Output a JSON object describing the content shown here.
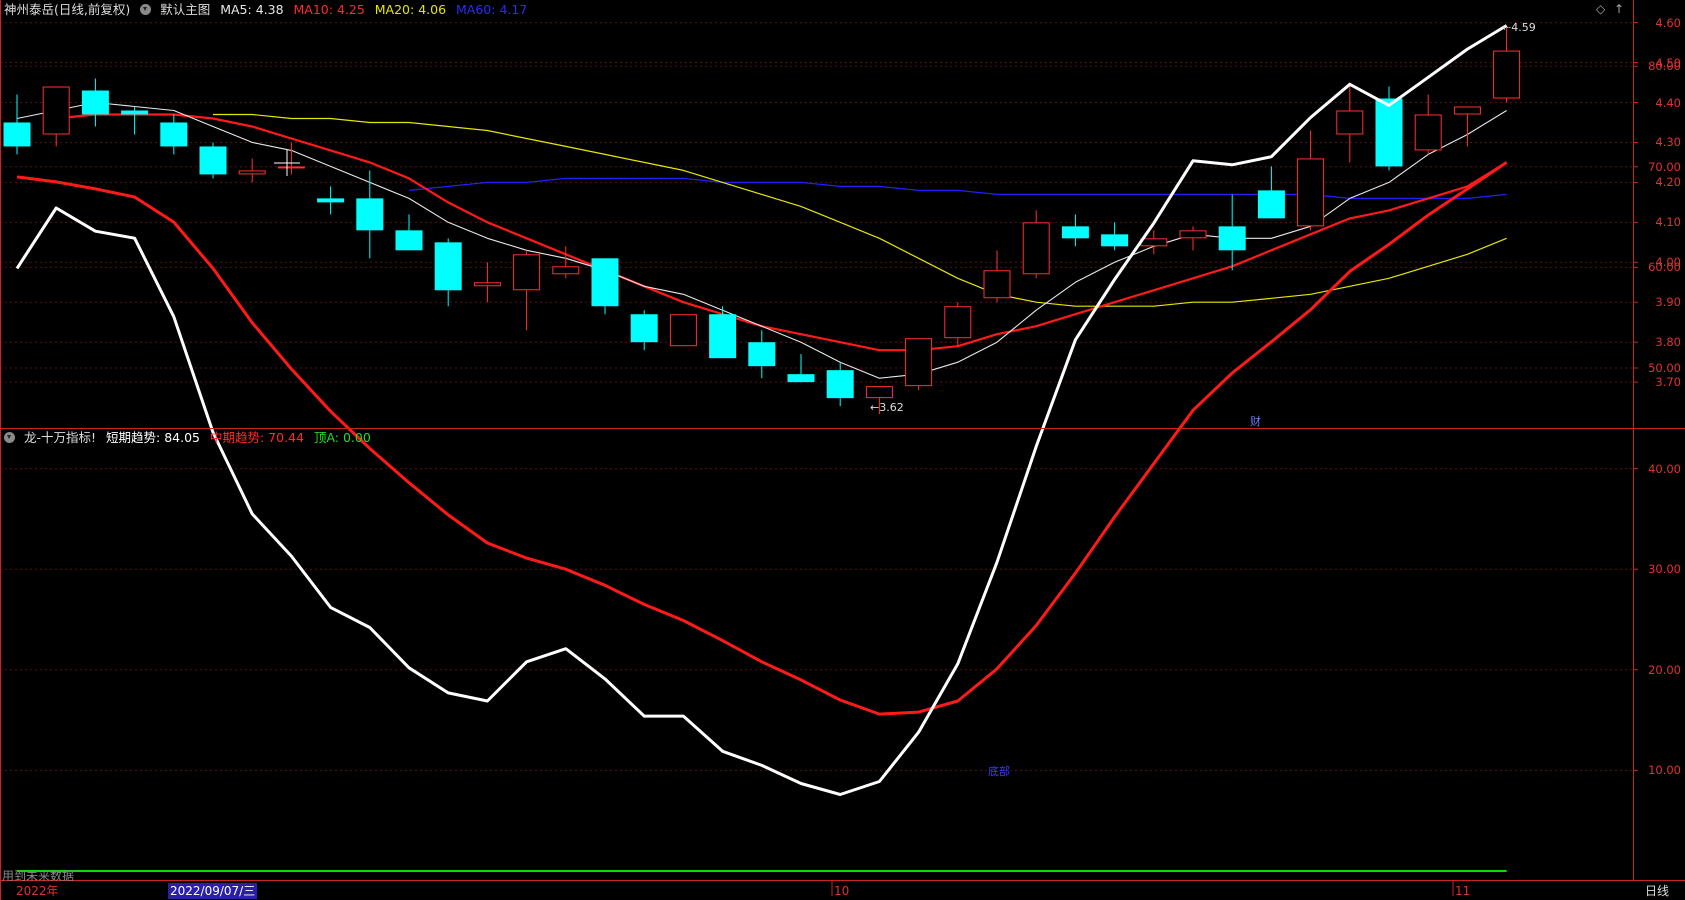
{
  "header": {
    "stock": "神州泰岳(日线,前复权)",
    "main_chart": "默认主图",
    "ma5": "MA5: 4.38",
    "ma10": "MA10: 4.25",
    "ma20": "MA20: 4.06",
    "ma60": "MA60: 4.17"
  },
  "indicator": {
    "name": "龙-十万指标!",
    "short": "短期趋势: 84.05",
    "mid": "中期趋势: 70.44",
    "top": "顶A: 0.00"
  },
  "footer": {
    "future_data": "用到未来数据",
    "year": "2022年",
    "date": "2022/09/07/三",
    "m10": "10",
    "m11": "11",
    "period": "日线"
  },
  "annotations": {
    "high": "4.59",
    "low": "3.62",
    "cai": "财",
    "signal": "底部"
  },
  "colors": {
    "up": "#ff3030",
    "down": "#00ffff",
    "ma5": "#e8e8e8",
    "ma10": "#ff1a1a",
    "ma20": "#e6e600",
    "ma60": "#2020ff",
    "short": "#ffffff",
    "mid": "#ff1a1a",
    "top": "#00e000",
    "axis": "#cc2222"
  },
  "chart_data": [
    {
      "type": "candlestick",
      "title": "神州泰岳(日线,前复权)",
      "ylim": [
        3.6,
        4.62
      ],
      "yticks": [
        "3.70",
        "3.80",
        "3.90",
        "4.00",
        "4.10",
        "4.20",
        "4.30",
        "4.40",
        "4.50",
        "4.60"
      ],
      "candles": [
        {
          "o": 4.35,
          "h": 4.42,
          "l": 4.27,
          "c": 4.29
        },
        {
          "o": 4.32,
          "h": 4.44,
          "l": 4.29,
          "c": 4.44
        },
        {
          "o": 4.43,
          "h": 4.46,
          "l": 4.34,
          "c": 4.37
        },
        {
          "o": 4.38,
          "h": 4.39,
          "l": 4.32,
          "c": 4.37
        },
        {
          "o": 4.35,
          "h": 4.37,
          "l": 4.27,
          "c": 4.29
        },
        {
          "o": 4.29,
          "h": 4.3,
          "l": 4.21,
          "c": 4.22
        },
        {
          "o": 4.22,
          "h": 4.26,
          "l": 4.2,
          "c": 4.23
        },
        {
          "o": 4.24,
          "h": 4.3,
          "l": 4.22,
          "c": 4.24
        },
        {
          "o": 4.16,
          "h": 4.19,
          "l": 4.12,
          "c": 4.15
        },
        {
          "o": 4.16,
          "h": 4.23,
          "l": 4.01,
          "c": 4.08
        },
        {
          "o": 4.08,
          "h": 4.12,
          "l": 4.03,
          "c": 4.03
        },
        {
          "o": 4.05,
          "h": 4.06,
          "l": 3.89,
          "c": 3.93
        },
        {
          "o": 3.94,
          "h": 4.0,
          "l": 3.9,
          "c": 3.95
        },
        {
          "o": 3.93,
          "h": 4.03,
          "l": 3.83,
          "c": 4.02
        },
        {
          "o": 3.97,
          "h": 4.04,
          "l": 3.96,
          "c": 3.99
        },
        {
          "o": 4.01,
          "h": 4.01,
          "l": 3.87,
          "c": 3.89
        },
        {
          "o": 3.87,
          "h": 3.88,
          "l": 3.78,
          "c": 3.8
        },
        {
          "o": 3.79,
          "h": 3.87,
          "l": 3.79,
          "c": 3.87
        },
        {
          "o": 3.87,
          "h": 3.89,
          "l": 3.76,
          "c": 3.76
        },
        {
          "o": 3.8,
          "h": 3.83,
          "l": 3.71,
          "c": 3.74
        },
        {
          "o": 3.72,
          "h": 3.77,
          "l": 3.7,
          "c": 3.7
        },
        {
          "o": 3.73,
          "h": 3.75,
          "l": 3.64,
          "c": 3.66
        },
        {
          "o": 3.66,
          "h": 3.69,
          "l": 3.62,
          "c": 3.69
        },
        {
          "o": 3.69,
          "h": 3.81,
          "l": 3.68,
          "c": 3.81
        },
        {
          "o": 3.81,
          "h": 3.9,
          "l": 3.79,
          "c": 3.89
        },
        {
          "o": 3.91,
          "h": 4.03,
          "l": 3.9,
          "c": 3.98
        },
        {
          "o": 3.97,
          "h": 4.13,
          "l": 3.96,
          "c": 4.1
        },
        {
          "o": 4.09,
          "h": 4.12,
          "l": 4.04,
          "c": 4.06
        },
        {
          "o": 4.07,
          "h": 4.1,
          "l": 4.03,
          "c": 4.04
        },
        {
          "o": 4.04,
          "h": 4.08,
          "l": 4.02,
          "c": 4.06
        },
        {
          "o": 4.06,
          "h": 4.09,
          "l": 4.03,
          "c": 4.08
        },
        {
          "o": 4.09,
          "h": 4.17,
          "l": 3.98,
          "c": 4.03
        },
        {
          "o": 4.18,
          "h": 4.24,
          "l": 4.11,
          "c": 4.11
        },
        {
          "o": 4.09,
          "h": 4.33,
          "l": 4.08,
          "c": 4.26
        },
        {
          "o": 4.32,
          "h": 4.45,
          "l": 4.25,
          "c": 4.38
        },
        {
          "o": 4.41,
          "h": 4.44,
          "l": 4.23,
          "c": 4.24
        },
        {
          "o": 4.28,
          "h": 4.42,
          "l": 4.27,
          "c": 4.37
        },
        {
          "o": 4.37,
          "h": 4.39,
          "l": 4.29,
          "c": 4.39
        },
        {
          "o": 4.41,
          "h": 4.59,
          "l": 4.4,
          "c": 4.53
        }
      ],
      "ma": {
        "MA5": [
          4.36,
          4.38,
          4.4,
          4.39,
          4.38,
          4.34,
          4.3,
          4.28,
          4.24,
          4.2,
          4.16,
          4.1,
          4.06,
          4.03,
          4.01,
          3.98,
          3.94,
          3.92,
          3.88,
          3.84,
          3.8,
          3.75,
          3.71,
          3.72,
          3.75,
          3.8,
          3.88,
          3.95,
          4.0,
          4.04,
          4.07,
          4.06,
          4.06,
          4.09,
          4.16,
          4.2,
          4.27,
          4.32,
          4.38
        ],
        "MA10": [
          4.36,
          4.37,
          4.37,
          4.37,
          4.36,
          4.34,
          4.31,
          4.28,
          4.25,
          4.21,
          4.15,
          4.1,
          4.06,
          4.02,
          3.98,
          3.94,
          3.9,
          3.87,
          3.84,
          3.82,
          3.8,
          3.78,
          3.78,
          3.79,
          3.82,
          3.84,
          3.87,
          3.9,
          3.93,
          3.96,
          3.99,
          4.03,
          4.07,
          4.11,
          4.13,
          4.16,
          4.19,
          4.25
        ],
        "MA20": [
          4.37,
          4.37,
          4.36,
          4.36,
          4.35,
          4.35,
          4.34,
          4.33,
          4.31,
          4.29,
          4.27,
          4.25,
          4.23,
          4.2,
          4.17,
          4.14,
          4.1,
          4.06,
          4.01,
          3.96,
          3.92,
          3.9,
          3.89,
          3.89,
          3.89,
          3.9,
          3.9,
          3.91,
          3.92,
          3.94,
          3.96,
          3.99,
          4.02,
          4.06
        ],
        "MA60": [
          4.18,
          4.19,
          4.2,
          4.2,
          4.21,
          4.21,
          4.21,
          4.21,
          4.2,
          4.2,
          4.2,
          4.19,
          4.19,
          4.18,
          4.18,
          4.17,
          4.17,
          4.17,
          4.17,
          4.17,
          4.17,
          4.17,
          4.17,
          4.17,
          4.16,
          4.16,
          4.16,
          4.16,
          4.17
        ]
      },
      "high_label": 4.59,
      "low_label": 3.62
    },
    {
      "type": "line",
      "title": "龙-十万指标!",
      "ylim": [
        0,
        90
      ],
      "yticks": [
        "10.00",
        "20.00",
        "30.00",
        "40.00",
        "50.00",
        "60.00",
        "70.00",
        "80.00"
      ],
      "series": [
        {
          "name": "短期趋势",
          "values": [
            59.9,
            65.9,
            63.6,
            62.9,
            55.1,
            43.6,
            35.5,
            31.3,
            26.2,
            24.2,
            20.2,
            17.7,
            16.9,
            20.8,
            22.1,
            19.1,
            15.4,
            15.4,
            11.9,
            10.5,
            8.7,
            7.6,
            8.9,
            13.8,
            20.6,
            30.7,
            42.2,
            52.8,
            58.8,
            64.4,
            70.6,
            70.2,
            71.0,
            74.9,
            78.2,
            76.1,
            78.9,
            81.7,
            84.05
          ]
        },
        {
          "name": "中期趋势",
          "values": [
            69.0,
            68.5,
            67.8,
            67.0,
            64.5,
            59.9,
            54.5,
            49.9,
            45.7,
            42.0,
            38.6,
            35.4,
            32.6,
            31.1,
            30.0,
            28.4,
            26.5,
            24.9,
            22.9,
            20.8,
            19.0,
            17.0,
            15.6,
            15.8,
            16.9,
            20.1,
            24.4,
            29.6,
            35.2,
            40.5,
            45.8,
            49.5,
            52.6,
            55.8,
            59.6,
            62.3,
            65.2,
            67.8,
            70.44
          ]
        },
        {
          "name": "顶A",
          "values": [
            0,
            0,
            0,
            0,
            0,
            0,
            0,
            0,
            0,
            0,
            0,
            0,
            0,
            0,
            0,
            0,
            0,
            0,
            0,
            0,
            0,
            0,
            0,
            0,
            0,
            0,
            0,
            0,
            0,
            0,
            0,
            0,
            0,
            0,
            0,
            0,
            0,
            0,
            0.0
          ]
        }
      ]
    }
  ]
}
